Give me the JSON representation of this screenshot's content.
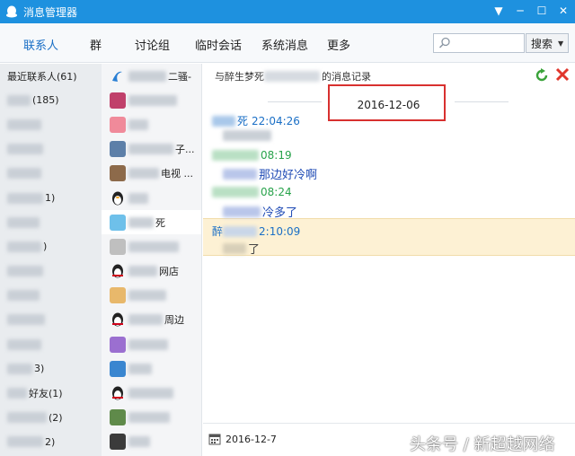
{
  "window": {
    "title": "消息管理器"
  },
  "nav": {
    "tabs": [
      {
        "label": "联系人",
        "active": true
      },
      {
        "label": "群"
      },
      {
        "label": "讨论组"
      },
      {
        "label": "临时会话"
      },
      {
        "label": "系统消息"
      },
      {
        "label": "更多"
      }
    ],
    "search": {
      "placeholder": "",
      "button_label": "搜索"
    }
  },
  "left_panel": {
    "items": [
      {
        "label": "最近联系人(61)"
      },
      {
        "label": "(185)"
      },
      {
        "label": ""
      },
      {
        "label": ""
      },
      {
        "label": ""
      },
      {
        "label": "1)"
      },
      {
        "label": ""
      },
      {
        "label": ")"
      },
      {
        "label": ""
      },
      {
        "label": ""
      },
      {
        "label": ""
      },
      {
        "label": ""
      },
      {
        "label": "3)"
      },
      {
        "label": "好友(1)"
      },
      {
        "label": "(2)"
      },
      {
        "label": "2)"
      },
      {
        "label": ""
      }
    ]
  },
  "middle_panel": {
    "items": [
      {
        "label": "二骚-"
      },
      {
        "label": ""
      },
      {
        "label": ""
      },
      {
        "label": "子..."
      },
      {
        "label": "电视 ..."
      },
      {
        "label": ""
      },
      {
        "label": "死",
        "selected": true
      },
      {
        "label": ""
      },
      {
        "label": "网店"
      },
      {
        "label": ""
      },
      {
        "label": "周边"
      },
      {
        "label": ""
      },
      {
        "label": ""
      },
      {
        "label": ""
      },
      {
        "label": ""
      },
      {
        "label": ""
      }
    ]
  },
  "record": {
    "header_prefix": "与醉生梦死",
    "header_suffix": "的消息记录",
    "date": "2016-12-06",
    "messages": [
      {
        "name": "死",
        "time": "22:04:26",
        "color": "blue",
        "text": "",
        "text_color": "gray"
      },
      {
        "name": "",
        "time": "08:19",
        "color": "green",
        "text": "那边好冷啊",
        "text_color": "blue"
      },
      {
        "name": "",
        "time": "08:24",
        "color": "green",
        "text": "冷多了",
        "text_color": "blue"
      },
      {
        "name": "醉",
        "time": "2:10:09",
        "color": "blue",
        "text": "了",
        "text_color": "gray"
      }
    ],
    "footer_date": "2016-12-7"
  },
  "watermark": "头条号 / 新超越网络",
  "colors": {
    "titlebar": "#1e91df",
    "accent_blue": "#1a6fc6",
    "accent_green": "#27a24a",
    "highlight_box": "#d8302f"
  }
}
